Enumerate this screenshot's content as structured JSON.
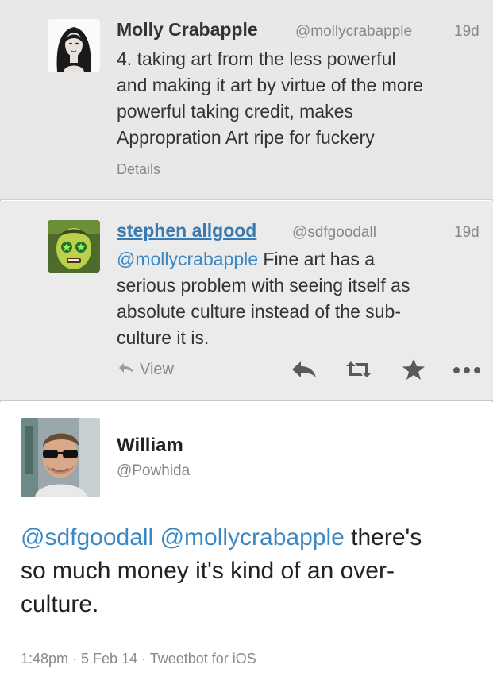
{
  "tweets": [
    {
      "name": "Molly Crabapple",
      "handle": "@mollycrabapple",
      "time": "19d",
      "lines": [
        "4. taking art from the less powerful",
        "and making it art by virtue of the more",
        "powerful taking credit, makes",
        "Appropration Art ripe for fuckery"
      ],
      "details_label": "Details"
    },
    {
      "name": "stephen allgood",
      "handle": "@sdfgoodall",
      "time": "19d",
      "mention": "@mollycrabapple",
      "lines": [
        " Fine art has a",
        "serious problem with seeing itself as",
        "absolute culture instead of the sub-",
        "culture it is."
      ],
      "view_label": "View",
      "actions": [
        "reply-icon",
        "retweet-icon",
        "favorite-icon",
        "more-icon"
      ]
    },
    {
      "name": "William",
      "handle": "@Powhida",
      "mentions": [
        "@sdfgoodall",
        "@mollycrabapple"
      ],
      "lines": [
        " there's",
        "so much money it's kind of an over-",
        "culture."
      ],
      "footer": "1:48pm · 5 Feb 14 · Tweetbot for iOS"
    }
  ],
  "colors": {
    "mention": "#3b88c3",
    "muted": "#888888",
    "selected_bg": "#e8e8e8"
  }
}
